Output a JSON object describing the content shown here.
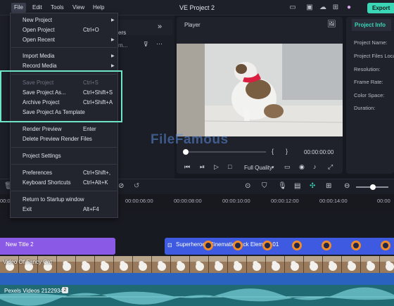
{
  "menubar": {
    "items": [
      "File",
      "Edit",
      "Tools",
      "View",
      "Help"
    ],
    "active": "File"
  },
  "window": {
    "title": "VE Project 2",
    "export_label": "Export"
  },
  "file_menu": {
    "items": [
      {
        "label": "New Project",
        "shortcut": "",
        "submenu": true,
        "disabled": false
      },
      {
        "label": "Open Project",
        "shortcut": "Ctrl+O",
        "submenu": false,
        "disabled": false
      },
      {
        "label": "Open Recent",
        "shortcut": "",
        "submenu": true,
        "disabled": false
      },
      {
        "label": "Import Media",
        "shortcut": "",
        "submenu": true,
        "disabled": false
      },
      {
        "label": "Record Media",
        "shortcut": "",
        "submenu": true,
        "disabled": false
      },
      {
        "label": "Save Project",
        "shortcut": "Ctrl+S",
        "submenu": false,
        "disabled": true
      },
      {
        "label": "Save Project As...",
        "shortcut": "Ctrl+Shift+S",
        "submenu": false,
        "disabled": false
      },
      {
        "label": "Archive Project",
        "shortcut": "Ctrl+Shift+A",
        "submenu": false,
        "disabled": false
      },
      {
        "label": "Save Project As Template",
        "shortcut": "",
        "submenu": false,
        "disabled": false
      },
      {
        "label": "Render Preview",
        "shortcut": "Enter",
        "submenu": false,
        "disabled": false
      },
      {
        "label": "Delete Preview Render Files",
        "shortcut": "",
        "submenu": false,
        "disabled": false
      },
      {
        "label": "Project Settings",
        "shortcut": "",
        "submenu": false,
        "disabled": false
      },
      {
        "label": "Preferences",
        "shortcut": "Ctrl+Shift+,",
        "submenu": false,
        "disabled": false
      },
      {
        "label": "Keyboard Shortcuts",
        "shortcut": "Ctrl+Alt+K",
        "submenu": false,
        "disabled": false
      },
      {
        "label": "Return to Startup window",
        "shortcut": "",
        "submenu": false,
        "disabled": false
      },
      {
        "label": "Exit",
        "shortcut": "Alt+F4",
        "submenu": false,
        "disabled": false
      }
    ]
  },
  "left_panel": {
    "tab_fragment": "cers",
    "search_fragment": "m..."
  },
  "player": {
    "label": "Player",
    "timecode": "00:00:00:00",
    "quality": "Full Quality",
    "progress": 0.0
  },
  "project_info": {
    "title": "Project Info",
    "labels": [
      "Project Name:",
      "Project Files Loca",
      "Resolution:",
      "Frame Rate:",
      "Color Space:",
      "Duration:"
    ]
  },
  "timeline": {
    "ruler": [
      "00:00",
      "00:00:06:00",
      "00:00:08:00",
      "00:00:10:00",
      "00:00:12:00",
      "00:00:14:00",
      "00:00"
    ],
    "clips": {
      "title": "New Title 2",
      "element": "Superheroes Cinematic Pack Element 01",
      "video": "Video Of Fancy Cat",
      "audio": "Pexels Videos 2122934",
      "audio_badge": "2"
    }
  },
  "watermark": "FileFamous",
  "colors": {
    "accent": "#3ad6b6",
    "title_clip": "#8a5ae6",
    "element_clip": "#3d5ae0",
    "highlight": "#6ee6c6"
  }
}
